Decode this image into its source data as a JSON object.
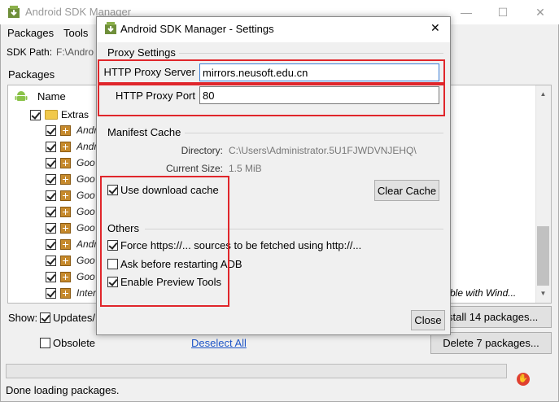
{
  "main": {
    "title": "Android SDK Manager",
    "menu": [
      "Packages",
      "Tools"
    ],
    "sdk_path_label": "SDK Path:",
    "sdk_path_value": "F:\\Andro",
    "packages_label": "Packages",
    "column_name": "Name",
    "extras_label": "Extras",
    "rows": [
      "Andr",
      "Andr",
      "Goo",
      "Goo",
      "Goo",
      "Goo",
      "Goo",
      "Andr",
      "Goo",
      "Goo",
      "Inter"
    ],
    "partial_row_text": "ble with Wind...",
    "show_label": "Show:",
    "updates_label": "Updates/",
    "obsolete_label": "Obsolete",
    "deselect_all": "Deselect All",
    "install_button": "stall 14 packages...",
    "delete_button": "Delete 7 packages...",
    "status": "Done loading packages.",
    "window_controls": {
      "minimize": "—",
      "maximize": "☐",
      "close": "✕"
    }
  },
  "dialog": {
    "title": "Android SDK Manager - Settings",
    "close_glyph": "✕",
    "proxy_section": "Proxy Settings",
    "proxy_server_label": "HTTP Proxy Server",
    "proxy_server_value": "mirrors.neusoft.edu.cn",
    "proxy_port_label": "HTTP Proxy Port",
    "proxy_port_value": "80",
    "manifest_section": "Manifest Cache",
    "directory_label": "Directory:",
    "directory_value": "C:\\Users\\Administrator.5U1FJWDVNJEHQ\\",
    "current_size_label": "Current Size:",
    "current_size_value": "1.5 MiB",
    "use_download_cache": "Use download cache",
    "clear_cache": "Clear Cache",
    "others_section": "Others",
    "force_https": "Force https://... sources to be fetched using http://...",
    "ask_before_restart": "Ask before restarting ADB",
    "enable_preview": "Enable Preview Tools",
    "close_button": "Close"
  },
  "colors": {
    "highlight": "#e0262b",
    "link": "#1f56c8",
    "android_green": "#8bc34a",
    "title_gray": "#999999"
  }
}
